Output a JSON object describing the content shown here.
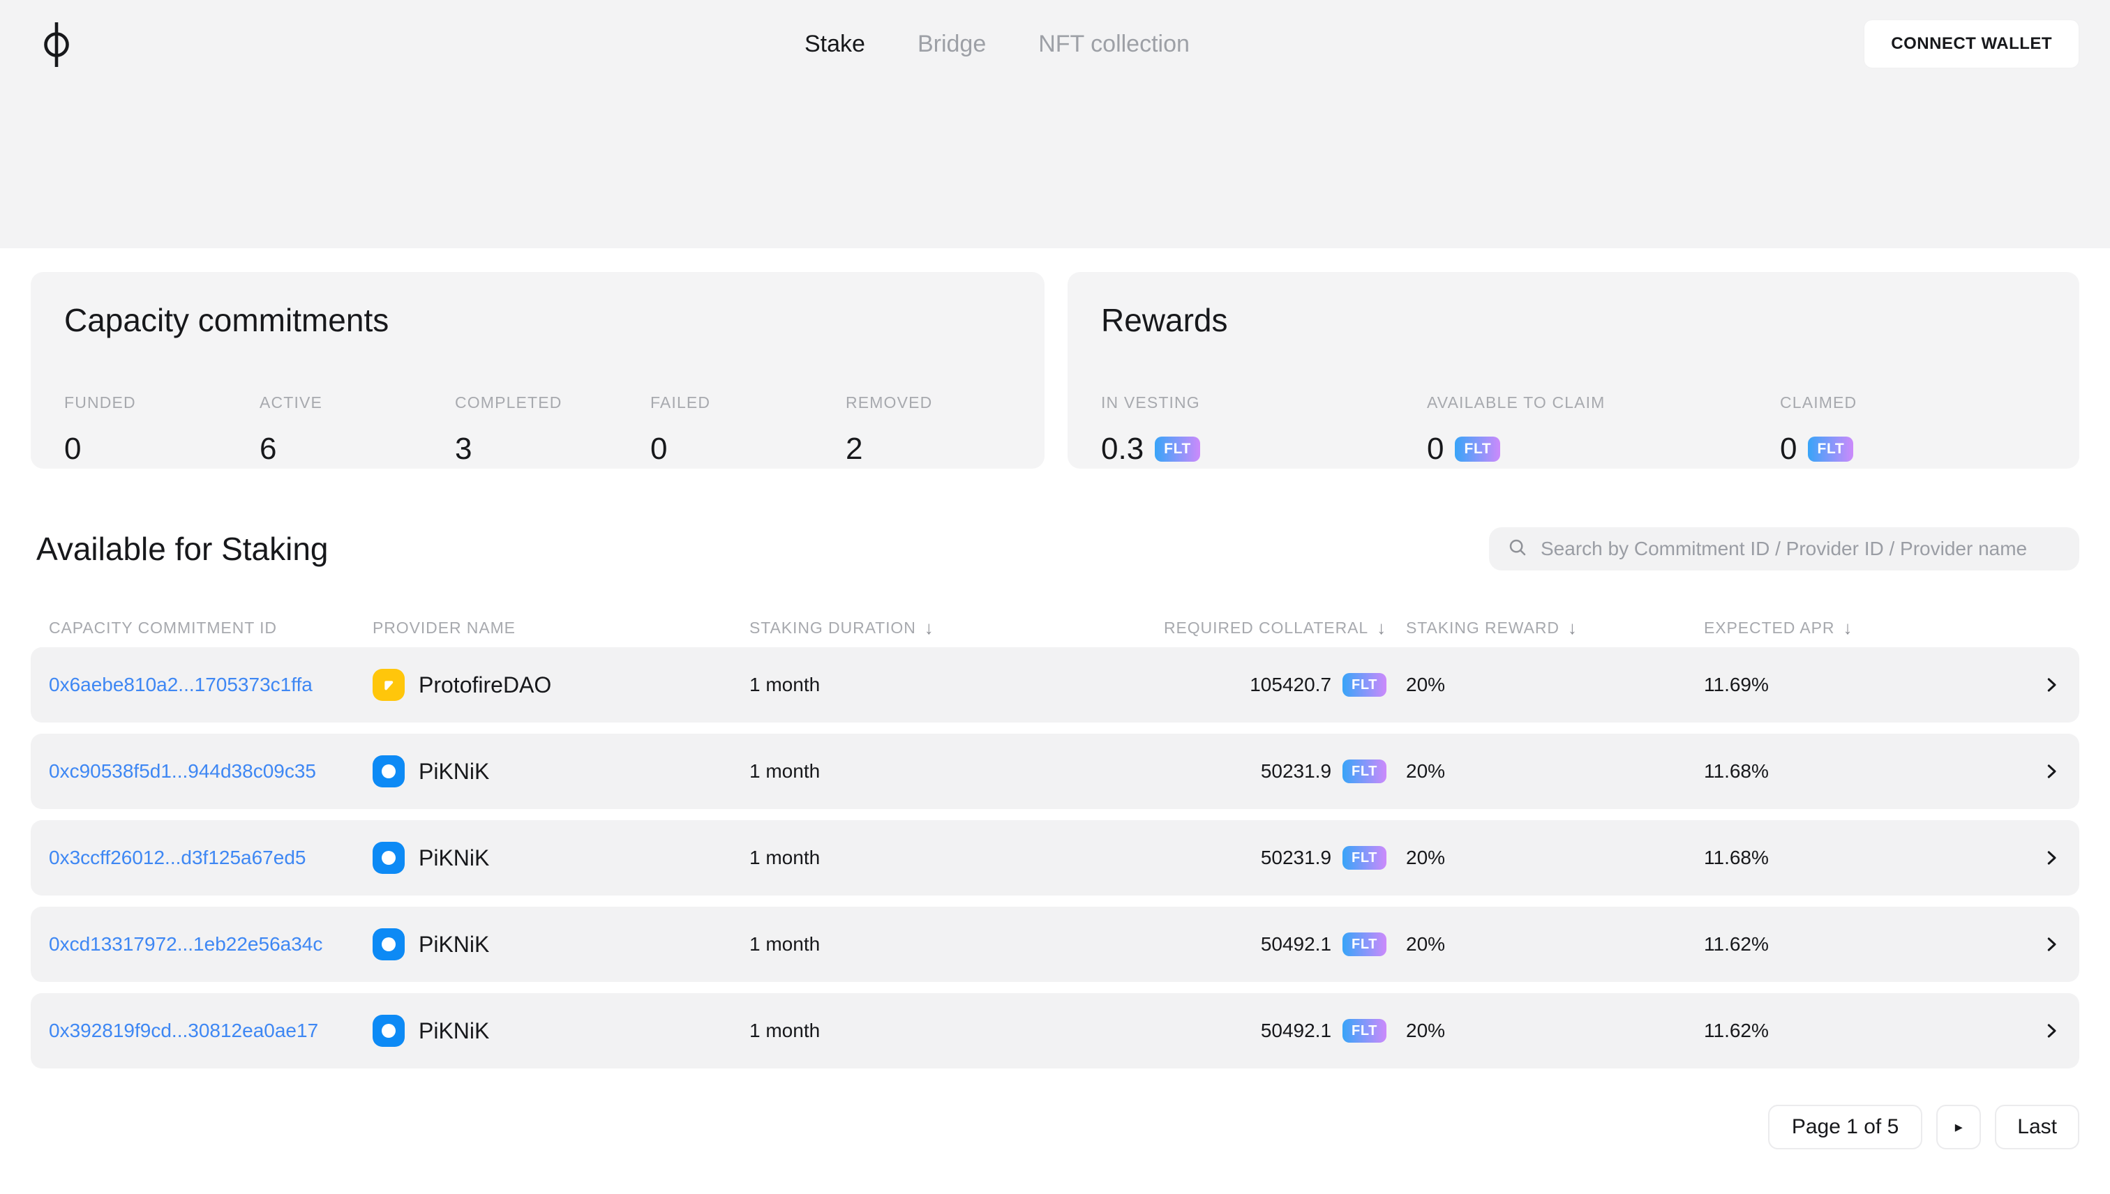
{
  "nav": {
    "items": [
      {
        "label": "Stake"
      },
      {
        "label": "Bridge"
      },
      {
        "label": "NFT collection"
      }
    ],
    "connect_wallet_label": "CONNECT WALLET"
  },
  "capacity_card": {
    "title": "Capacity commitments",
    "stats": [
      {
        "label": "FUNDED",
        "value": "0"
      },
      {
        "label": "ACTIVE",
        "value": "6"
      },
      {
        "label": "COMPLETED",
        "value": "3"
      },
      {
        "label": "FAILED",
        "value": "0"
      },
      {
        "label": "REMOVED",
        "value": "2"
      }
    ]
  },
  "rewards_card": {
    "title": "Rewards",
    "stats": [
      {
        "label": "IN VESTING",
        "value": "0.3",
        "token": "FLT"
      },
      {
        "label": "AVAILABLE TO CLAIM",
        "value": "0",
        "token": "FLT"
      },
      {
        "label": "CLAIMED",
        "value": "0",
        "token": "FLT"
      }
    ]
  },
  "staking": {
    "title": "Available for Staking",
    "search_placeholder": "Search by Commitment ID / Provider ID / Provider name",
    "sort_icon": "↓",
    "columns": [
      {
        "label": "CAPACITY COMMITMENT ID"
      },
      {
        "label": "PROVIDER NAME"
      },
      {
        "label": "STAKING DURATION"
      },
      {
        "label": "REQUIRED COLLATERAL"
      },
      {
        "label": "STAKING REWARD"
      },
      {
        "label": "EXPECTED APR"
      }
    ],
    "rows": [
      {
        "id": "0x6aebe810a2...1705373c1ffa",
        "provider": "ProtofireDAO",
        "avatar": "protofire",
        "duration": "1 month",
        "collateral": "105420.7",
        "token": "FLT",
        "reward": "20%",
        "apr": "11.69%"
      },
      {
        "id": "0xc90538f5d1...944d38c09c35",
        "provider": "PiKNiK",
        "avatar": "piknik",
        "duration": "1 month",
        "collateral": "50231.9",
        "token": "FLT",
        "reward": "20%",
        "apr": "11.68%"
      },
      {
        "id": "0x3ccff26012...d3f125a67ed5",
        "provider": "PiKNiK",
        "avatar": "piknik",
        "duration": "1 month",
        "collateral": "50231.9",
        "token": "FLT",
        "reward": "20%",
        "apr": "11.68%"
      },
      {
        "id": "0xcd13317972...1eb22e56a34c",
        "provider": "PiKNiK",
        "avatar": "piknik",
        "duration": "1 month",
        "collateral": "50492.1",
        "token": "FLT",
        "reward": "20%",
        "apr": "11.62%"
      },
      {
        "id": "0x392819f9cd...30812ea0ae17",
        "provider": "PiKNiK",
        "avatar": "piknik",
        "duration": "1 month",
        "collateral": "50492.1",
        "token": "FLT",
        "reward": "20%",
        "apr": "11.62%"
      }
    ],
    "pagination": {
      "page_label": "Page 1 of 5",
      "next_icon": "▸",
      "last_label": "Last"
    }
  },
  "colors": {
    "band_bg": "#f3f3f4",
    "card_bg": "#f4f4f5",
    "row_bg": "#f2f2f3",
    "link_blue": "#3e87f3",
    "badge_gradient_start": "#38a4f8",
    "badge_gradient_end": "#cc8afb",
    "avatar_protofire": "#ffc60b",
    "avatar_piknik": "#0d8af5"
  }
}
